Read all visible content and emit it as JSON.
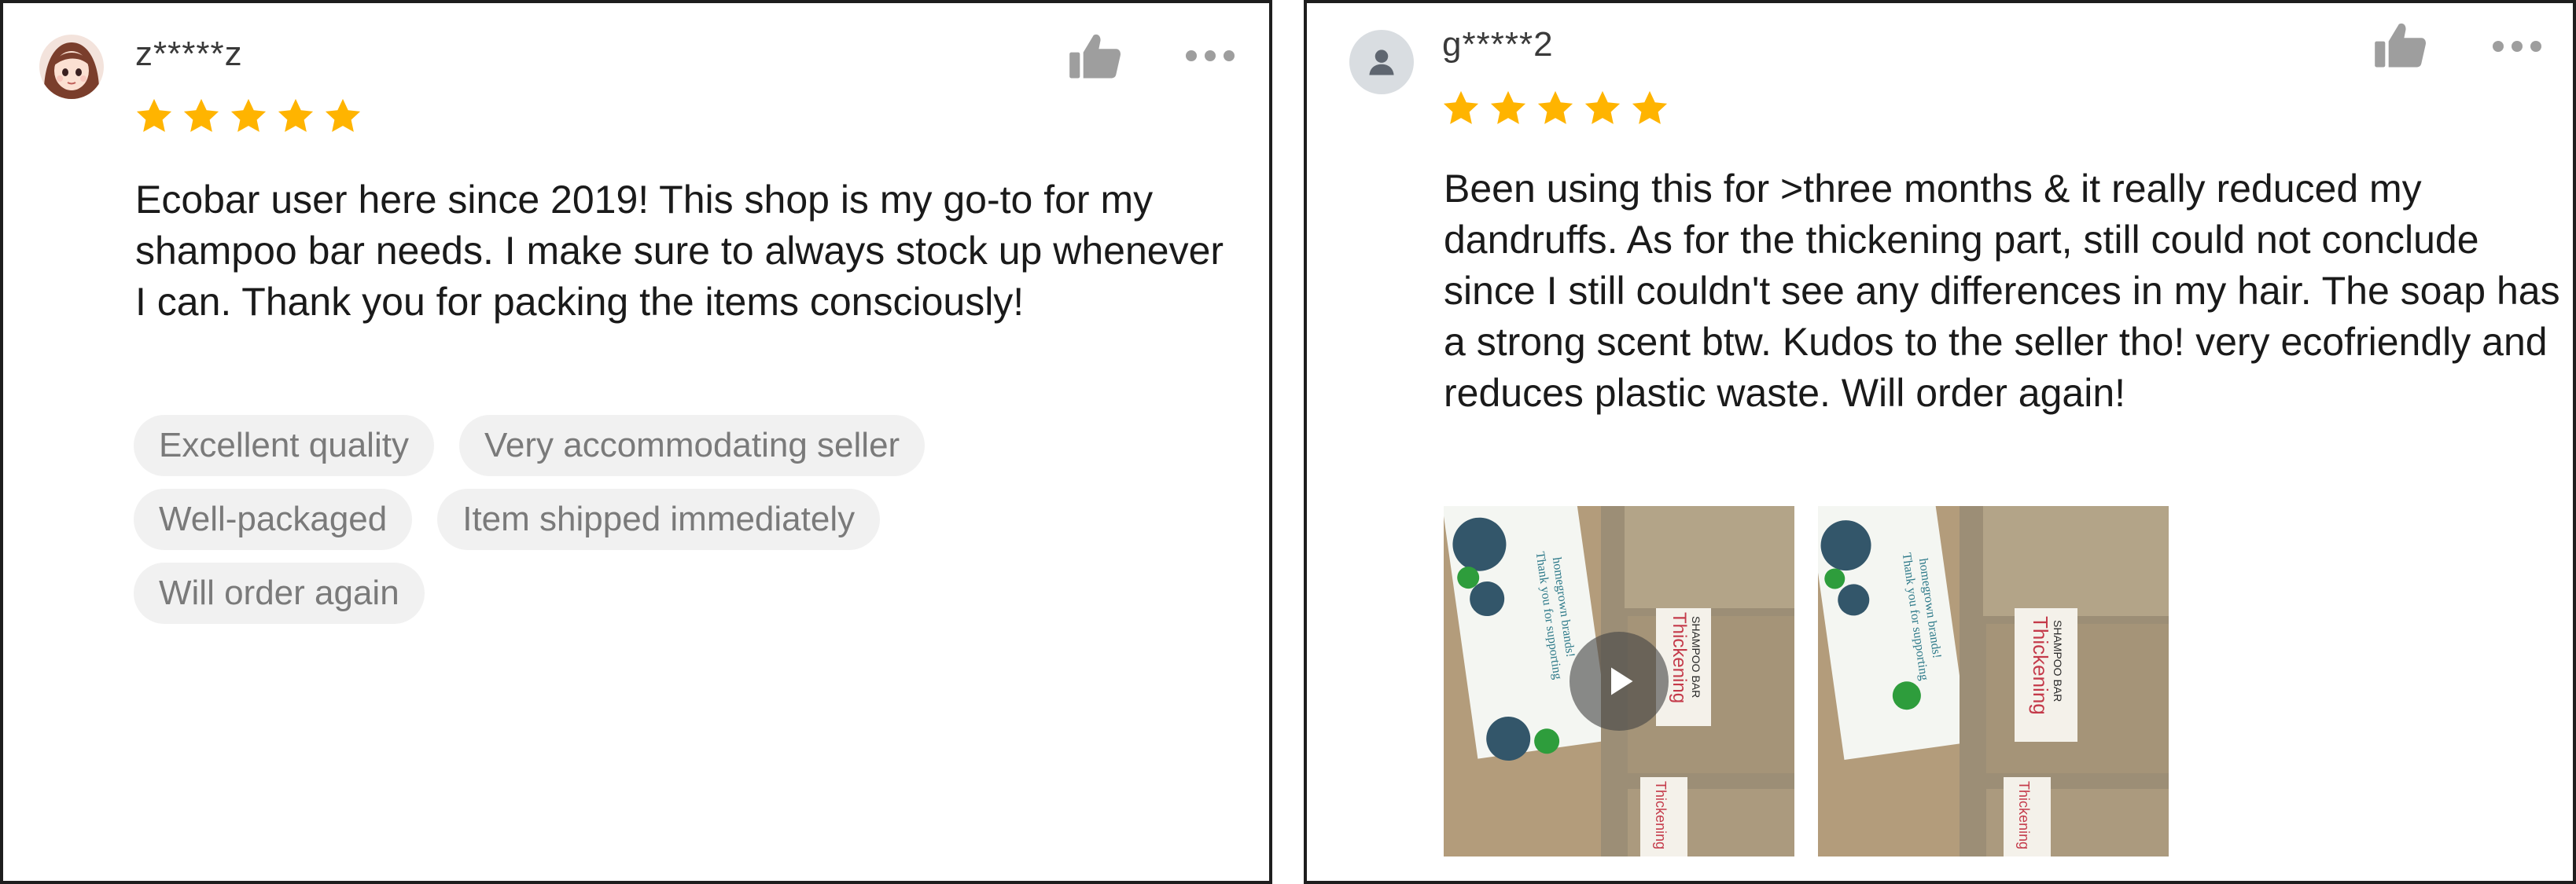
{
  "reviews": [
    {
      "username": "z*****z",
      "rating": 5,
      "text": "Ecobar user here since 2019! This shop is my go-to for my shampoo bar needs. I make sure to always stock up whenever I can. Thank you for packing the items consciously!",
      "tags": [
        "Excellent quality",
        "Very accommodating seller",
        "Well-packaged",
        "Item shipped immediately",
        "Will order again"
      ],
      "avatar_icon": "anime-girl-avatar-icon"
    },
    {
      "username": "g*****2",
      "rating": 5,
      "text": "Been using this for >three months & it really reduced my dandruffs. As for the thickening part, still could not conclude since I still couldn't see any differences in my hair. The soap has a strong scent btw. Kudos to the seller tho! very ecofriendly and reduces plastic waste. Will order again!",
      "avatar_icon": "default-user-icon",
      "media": [
        {
          "type": "video",
          "icon": "play-icon"
        },
        {
          "type": "photo"
        }
      ]
    }
  ],
  "icons": {
    "like": "thumbs-up-icon",
    "more": "more-options-icon",
    "star": "star-icon"
  },
  "colors": {
    "star": "#FFB400",
    "icon_gray": "#9e9e9e",
    "tag_bg": "#f1f1f1",
    "tag_text": "#7a7a7a"
  }
}
